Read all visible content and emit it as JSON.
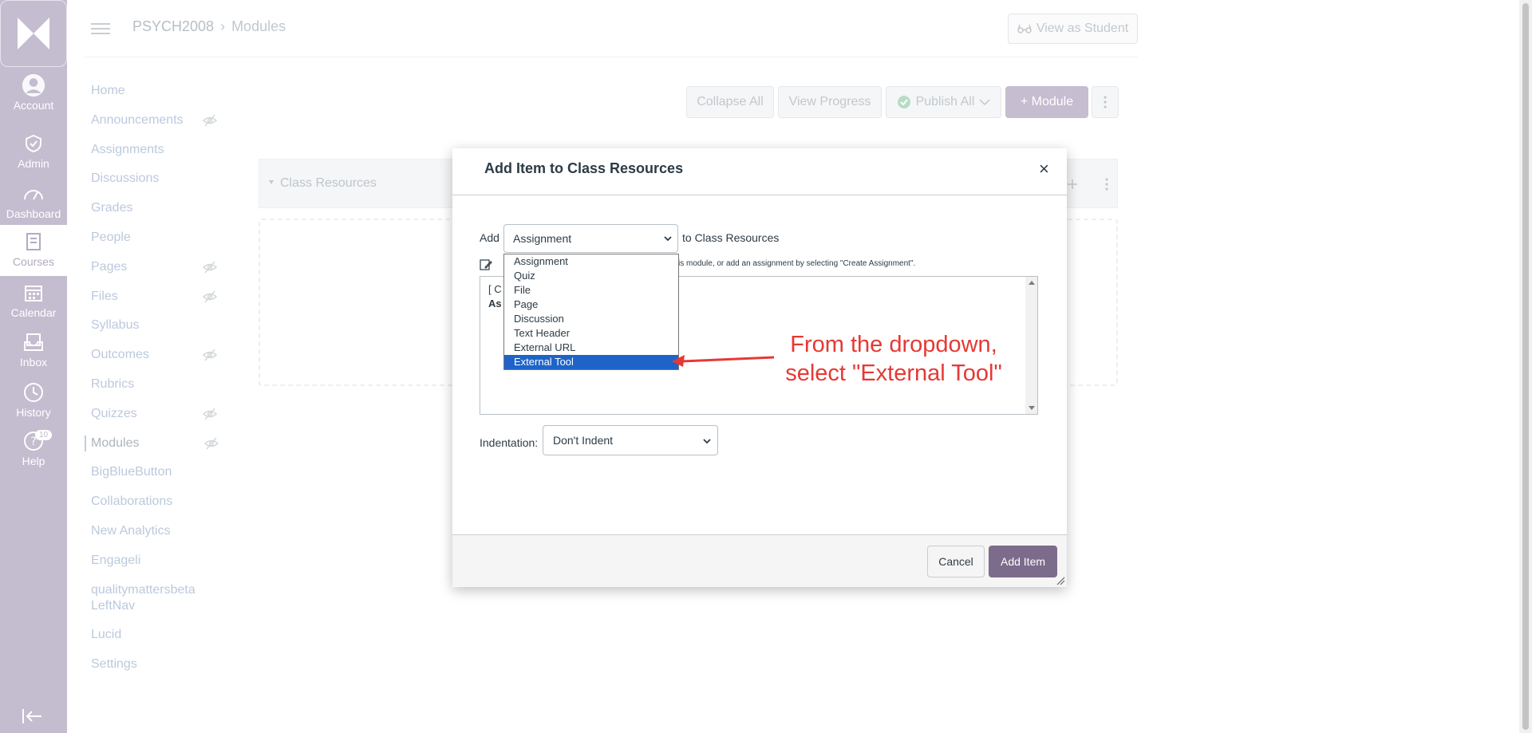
{
  "global_nav": {
    "items": [
      {
        "label": "Account",
        "icon": "account-icon"
      },
      {
        "label": "Admin",
        "icon": "admin-icon"
      },
      {
        "label": "Dashboard",
        "icon": "dashboard-icon"
      },
      {
        "label": "Courses",
        "icon": "courses-icon"
      },
      {
        "label": "Calendar",
        "icon": "calendar-icon"
      },
      {
        "label": "Inbox",
        "icon": "inbox-icon"
      },
      {
        "label": "History",
        "icon": "history-icon"
      },
      {
        "label": "Help",
        "icon": "help-icon",
        "badge": "10"
      }
    ]
  },
  "header": {
    "course": "PSYCH2008",
    "separator": "›",
    "page": "Modules",
    "view_as_student": "View as Student"
  },
  "course_nav": {
    "items": [
      {
        "label": "Home"
      },
      {
        "label": "Announcements",
        "hidden_icon": true
      },
      {
        "label": "Assignments"
      },
      {
        "label": "Discussions"
      },
      {
        "label": "Grades"
      },
      {
        "label": "People"
      },
      {
        "label": "Pages",
        "hidden_icon": true
      },
      {
        "label": "Files",
        "hidden_icon": true
      },
      {
        "label": "Syllabus"
      },
      {
        "label": "Outcomes",
        "hidden_icon": true
      },
      {
        "label": "Rubrics"
      },
      {
        "label": "Quizzes",
        "hidden_icon": true
      },
      {
        "label": "Modules",
        "hidden_icon": true,
        "active": true
      },
      {
        "label": "BigBlueButton"
      },
      {
        "label": "Collaborations"
      },
      {
        "label": "New Analytics"
      },
      {
        "label": "Engageli"
      },
      {
        "label": "qualitymattersbeta",
        "label2": "LeftNav"
      },
      {
        "label": "Lucid"
      },
      {
        "label": "Settings"
      }
    ]
  },
  "toolbar": {
    "collapse_all": "Collapse All",
    "view_progress": "View Progress",
    "publish_all": "Publish All",
    "add_module": "+ Module"
  },
  "module": {
    "title": "Class Resources"
  },
  "modal": {
    "title": "Add Item to Class Resources",
    "close": "×",
    "add_label": "Add",
    "type_value": "Assignment",
    "to_label": "to Class Resources",
    "helper_text": "th this module, or add an assignment by selecting \"Create Assignment\".",
    "list_line1": "[ C",
    "list_line2": "As",
    "indent_label": "Indentation:",
    "indent_value": "Don't Indent",
    "cancel": "Cancel",
    "add_item": "Add Item"
  },
  "dropdown": {
    "options": [
      "Assignment",
      "Quiz",
      "File",
      "Page",
      "Discussion",
      "Text Header",
      "External URL",
      "External Tool"
    ],
    "selected": "External Tool"
  },
  "annotation": {
    "line1": "From the dropdown,",
    "line2": "select \"External Tool\""
  },
  "colors": {
    "global_nav": "#c4bccf",
    "primary_button": "#7d6b8c",
    "dropdown_selected": "#1e64c8",
    "annotation": "#e53935"
  }
}
